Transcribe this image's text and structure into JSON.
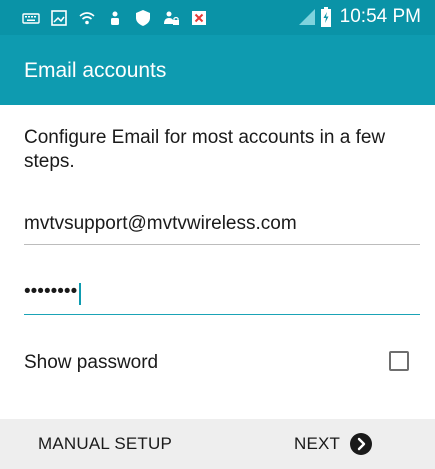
{
  "status_bar": {
    "time": "10:54 PM",
    "left_icons": [
      "keyboard-icon",
      "gallery-icon",
      "wifi-icon",
      "person-icon",
      "shield-icon",
      "lock-person-icon",
      "blocked-notification-icon"
    ],
    "right_icons": [
      "signal-icon",
      "battery-charging-icon"
    ]
  },
  "title_bar": {
    "title": "Email accounts"
  },
  "form": {
    "description": "Configure Email for most accounts in a few steps.",
    "email_value": "mvtvsupport@mvtvwireless.com",
    "password_masked": "••••••••",
    "show_password_label": "Show password",
    "show_password_checked": false
  },
  "bottom_bar": {
    "manual_setup_label": "MANUAL SETUP",
    "next_label": "NEXT"
  },
  "colors": {
    "accent": "#0e9bb0",
    "status_bar": "#0a93a7",
    "bottom_bar": "#eeeeee"
  }
}
